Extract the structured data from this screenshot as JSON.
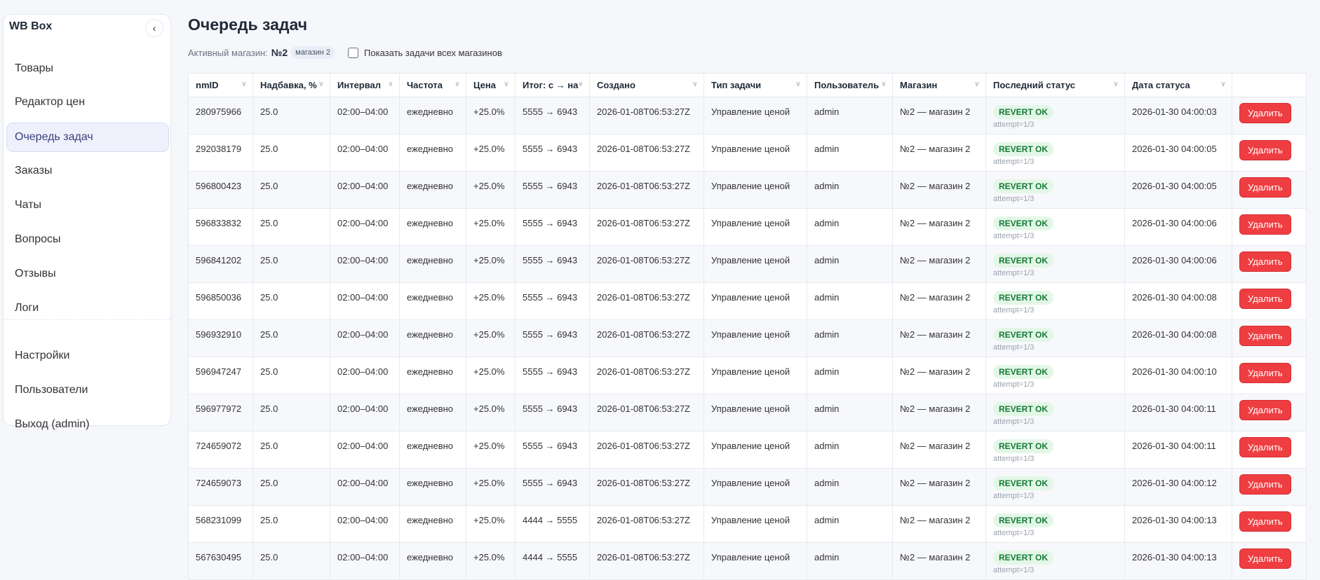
{
  "sidebar": {
    "brand": "WB Box",
    "collapse_icon": "chevron-left",
    "items": [
      {
        "label": "Товары"
      },
      {
        "label": "Редактор цен"
      },
      {
        "label": "Очередь задач",
        "active": true
      },
      {
        "label": "Заказы"
      },
      {
        "label": "Чаты"
      },
      {
        "label": "Вопросы"
      },
      {
        "label": "Отзывы"
      },
      {
        "label": "Логи"
      }
    ],
    "bottom_items": [
      {
        "label": "Настройки"
      },
      {
        "label": "Пользователи"
      },
      {
        "label": "Выход (admin)"
      }
    ]
  },
  "page": {
    "title": "Очередь задач",
    "active_shop_label": "Активный магазин:",
    "active_shop_value": "№2",
    "active_shop_pill": "магазин 2",
    "show_all_label": "Показать задачи всех магазинов",
    "show_all_checked": false
  },
  "colors": {
    "accent": "#3b3f7a",
    "danger": "#ef3e42",
    "success_bg": "#e3f7e7",
    "success_text": "#167a37"
  },
  "table": {
    "columns": [
      "nmID",
      "Надбавка, %",
      "Интервал",
      "Частота",
      "Цена",
      "Итог: с → на",
      "Создано",
      "Тип задачи",
      "Пользователь",
      "Магазин",
      "Последний статус",
      "Дата статуса",
      ""
    ],
    "delete_label": "Удалить",
    "rows": [
      [
        "280975966",
        "25.0",
        "02:00–04:00",
        "ежедневно",
        "+25.0%",
        "5555 → 6943",
        "2026-01-08T06:53:27Z",
        "Управление ценой",
        "admin",
        "№2 — магазин 2",
        "REVERT OK",
        "attempt=1/3",
        "2026-01-30 04:00:03"
      ],
      [
        "292038179",
        "25.0",
        "02:00–04:00",
        "ежедневно",
        "+25.0%",
        "5555 → 6943",
        "2026-01-08T06:53:27Z",
        "Управление ценой",
        "admin",
        "№2 — магазин 2",
        "REVERT OK",
        "attempt=1/3",
        "2026-01-30 04:00:05"
      ],
      [
        "596800423",
        "25.0",
        "02:00–04:00",
        "ежедневно",
        "+25.0%",
        "5555 → 6943",
        "2026-01-08T06:53:27Z",
        "Управление ценой",
        "admin",
        "№2 — магазин 2",
        "REVERT OK",
        "attempt=1/3",
        "2026-01-30 04:00:05"
      ],
      [
        "596833832",
        "25.0",
        "02:00–04:00",
        "ежедневно",
        "+25.0%",
        "5555 → 6943",
        "2026-01-08T06:53:27Z",
        "Управление ценой",
        "admin",
        "№2 — магазин 2",
        "REVERT OK",
        "attempt=1/3",
        "2026-01-30 04:00:06"
      ],
      [
        "596841202",
        "25.0",
        "02:00–04:00",
        "ежедневно",
        "+25.0%",
        "5555 → 6943",
        "2026-01-08T06:53:27Z",
        "Управление ценой",
        "admin",
        "№2 — магазин 2",
        "REVERT OK",
        "attempt=1/3",
        "2026-01-30 04:00:06"
      ],
      [
        "596850036",
        "25.0",
        "02:00–04:00",
        "ежедневно",
        "+25.0%",
        "5555 → 6943",
        "2026-01-08T06:53:27Z",
        "Управление ценой",
        "admin",
        "№2 — магазин 2",
        "REVERT OK",
        "attempt=1/3",
        "2026-01-30 04:00:08"
      ],
      [
        "596932910",
        "25.0",
        "02:00–04:00",
        "ежедневно",
        "+25.0%",
        "5555 → 6943",
        "2026-01-08T06:53:27Z",
        "Управление ценой",
        "admin",
        "№2 — магазин 2",
        "REVERT OK",
        "attempt=1/3",
        "2026-01-30 04:00:08"
      ],
      [
        "596947247",
        "25.0",
        "02:00–04:00",
        "ежедневно",
        "+25.0%",
        "5555 → 6943",
        "2026-01-08T06:53:27Z",
        "Управление ценой",
        "admin",
        "№2 — магазин 2",
        "REVERT OK",
        "attempt=1/3",
        "2026-01-30 04:00:10"
      ],
      [
        "596977972",
        "25.0",
        "02:00–04:00",
        "ежедневно",
        "+25.0%",
        "5555 → 6943",
        "2026-01-08T06:53:27Z",
        "Управление ценой",
        "admin",
        "№2 — магазин 2",
        "REVERT OK",
        "attempt=1/3",
        "2026-01-30 04:00:11"
      ],
      [
        "724659072",
        "25.0",
        "02:00–04:00",
        "ежедневно",
        "+25.0%",
        "5555 → 6943",
        "2026-01-08T06:53:27Z",
        "Управление ценой",
        "admin",
        "№2 — магазин 2",
        "REVERT OK",
        "attempt=1/3",
        "2026-01-30 04:00:11"
      ],
      [
        "724659073",
        "25.0",
        "02:00–04:00",
        "ежедневно",
        "+25.0%",
        "5555 → 6943",
        "2026-01-08T06:53:27Z",
        "Управление ценой",
        "admin",
        "№2 — магазин 2",
        "REVERT OK",
        "attempt=1/3",
        "2026-01-30 04:00:12"
      ],
      [
        "568231099",
        "25.0",
        "02:00–04:00",
        "ежедневно",
        "+25.0%",
        "4444 → 5555",
        "2026-01-08T06:53:27Z",
        "Управление ценой",
        "admin",
        "№2 — магазин 2",
        "REVERT OK",
        "attempt=1/3",
        "2026-01-30 04:00:13"
      ],
      [
        "567630495",
        "25.0",
        "02:00–04:00",
        "ежедневно",
        "+25.0%",
        "4444 → 5555",
        "2026-01-08T06:53:27Z",
        "Управление ценой",
        "admin",
        "№2 — магазин 2",
        "REVERT OK",
        "attempt=1/3",
        "2026-01-30 04:00:13"
      ]
    ]
  }
}
